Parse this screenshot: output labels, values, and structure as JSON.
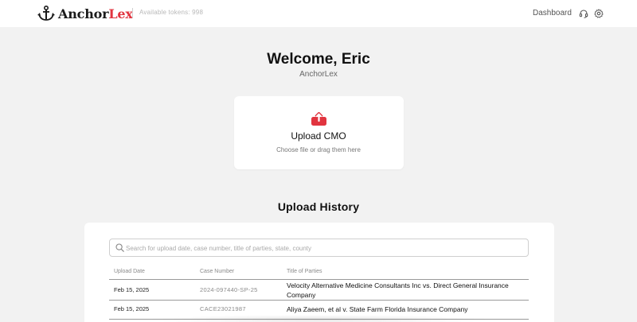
{
  "header": {
    "logo_text_main": "Anchor",
    "logo_text_accent": "Lex",
    "tokens_label": "Available tokens: 998",
    "nav_dashboard": "Dashboard",
    "icons": [
      "anchor-logo-icon",
      "headset-icon",
      "gear-icon"
    ]
  },
  "welcome": {
    "title": "Welcome, Eric",
    "subtitle": "AnchorLex"
  },
  "upload": {
    "title": "Upload CMO",
    "hint": "Choose file or drag them here",
    "icon": "upload-icon"
  },
  "history": {
    "title": "Upload History",
    "search_placeholder": "Search for upload date, case number, title of parties, state, county",
    "columns": [
      "Upload Date",
      "Case Number",
      "Title of Parties"
    ],
    "rows": [
      {
        "date": "Feb 15, 2025",
        "case_number": "2024-097440-SP-25",
        "title": "Velocity Alternative Medicine Consultants Inc vs. Direct General Insurance Company"
      },
      {
        "date": "Feb 15, 2025",
        "case_number": "CACE23021987",
        "title": "Aliya Zaeem, et al v. State Farm Florida Insurance Company"
      }
    ]
  },
  "colors": {
    "accent": "#e1343f",
    "background": "#f2f2f2",
    "card": "#ffffff"
  }
}
